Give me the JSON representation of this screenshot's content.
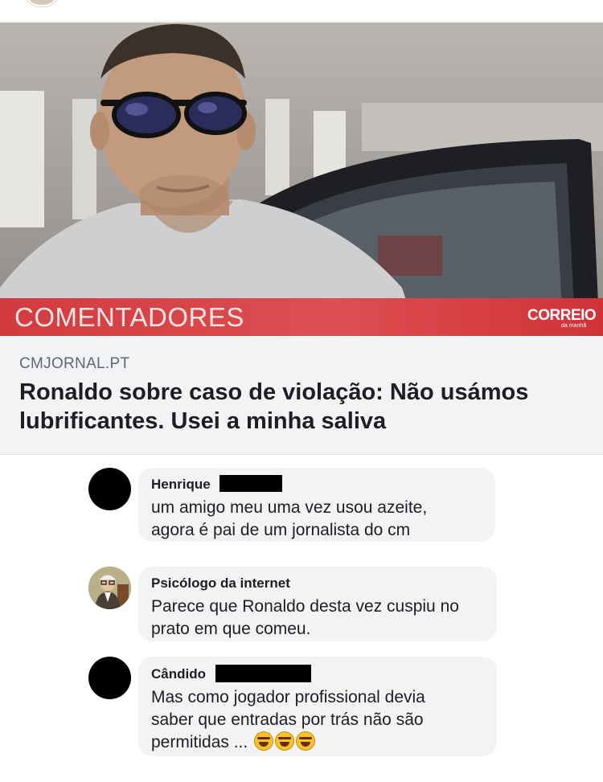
{
  "post_image": {
    "banner_label": "COMENTADORES",
    "logo_main": "CORREIO",
    "logo_sub": "da manhã"
  },
  "link_preview": {
    "domain": "CMJORNAL.PT",
    "headline": "Ronaldo sobre caso de violação: Não usámos lubrificantes. Usei a minha saliva"
  },
  "comments": [
    {
      "author": "Henrique",
      "author_redacted": true,
      "lines": [
        "um amigo meu uma vez usou azeite,",
        "agora é pai de um jornalista do cm"
      ]
    },
    {
      "author": "Psicólogo da internet",
      "author_redacted": false,
      "lines": [
        "Parece que Ronaldo desta vez cuspiu no",
        "prato em que comeu."
      ]
    },
    {
      "author": "Cândido",
      "author_redacted": true,
      "lines": [
        "Mas como jogador profissional devia",
        "saber que entradas por trás não são",
        "permitidas ..."
      ],
      "emoji": "rolling-on-floor-laughing",
      "emoji_count": 3
    }
  ]
}
